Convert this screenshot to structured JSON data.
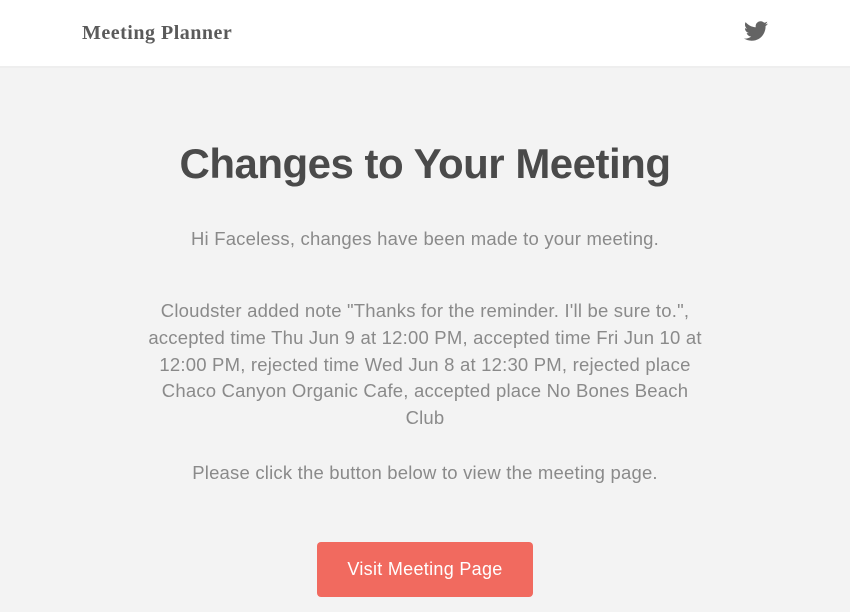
{
  "header": {
    "logo_text": "Meeting Planner"
  },
  "main": {
    "title": "Changes to Your Meeting",
    "greeting": "Hi Faceless, changes have been made to your meeting.",
    "changes_text": "Cloudster added note \"Thanks for the reminder. I'll be sure to.\", accepted time Thu Jun 9 at 12:00 PM, accepted time Fri Jun 10 at 12:00 PM, rejected time Wed Jun 8 at 12:30 PM, rejected place Chaco Canyon Organic Cafe, accepted place No Bones Beach Club",
    "instruction": "Please click the button below to view the meeting page.",
    "button_label": "Visit Meeting Page"
  }
}
